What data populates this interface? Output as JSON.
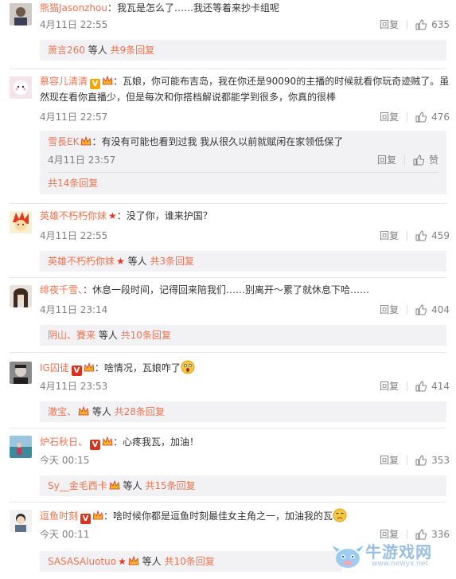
{
  "comments": [
    {
      "user": "熊猫Jasonzhou",
      "text": "：我瓦是怎么了……我还等着来抄卡组呢",
      "time": "4月11日 22:55",
      "reply": "回复",
      "likes": "635",
      "replies": {
        "user": "萧言260",
        "mid": " 等人 ",
        "count": "共9条回复"
      }
    },
    {
      "user": "慕容儿清清",
      "text1": "：瓦娘，你可能布吉岛，我在你还是90090的主播的时候就看你玩奇迹贼了。虽",
      "text2": "然现在看你直播少，但是每次和你搭档解说都能学到很多，你真的很棒",
      "time": "4月11日 22:57",
      "reply": "回复",
      "likes": "476",
      "sub": {
        "user": "雪長EK",
        "text": "：有没有可能也看到过我 我从很久以前就赋闲在家领低保了",
        "time": "4月11日 23:57",
        "reply": "回复",
        "likes": "赞"
      },
      "total": "共14条回复"
    },
    {
      "user": "英雄不朽朽你妹",
      "text": "：没了你，谁来护国？",
      "time": "4月11日 22:55",
      "reply": "回复",
      "likes": "459",
      "replies": {
        "user": "英雄不朽朽你妹",
        "mid": " 等人 ",
        "count": "共3条回复"
      }
    },
    {
      "user": "绯夜千雪、",
      "text": "：休息一段时间，记得回来陪我们……别离开～累了就休息下哈……",
      "time": "4月11日 23:14",
      "reply": "回复",
      "likes": "404",
      "replies": {
        "user": "阴山、賽来",
        "mid": " 等人 ",
        "count": "共10条回复"
      }
    },
    {
      "user": "IG囚徒",
      "text": "：啥情况，瓦娘咋了",
      "time": "4月11日 23:53",
      "reply": "回复",
      "likes": "414",
      "replies": {
        "user": "澈宝、",
        "mid": " 等人 ",
        "count": "共28条回复"
      }
    },
    {
      "user": "炉石秋日、",
      "text": "：心疼我瓦，加油！",
      "time": "今天 00:15",
      "reply": "回复",
      "likes": "353",
      "replies": {
        "user": "Sy__金毛西卡",
        "mid": " 等人 ",
        "count": "共15条回复"
      }
    },
    {
      "user": "逗鱼时刻",
      "text": "：啥时候你都是逗鱼时刻最佳女主角之一，加油我的瓦",
      "time": "今天 00:11",
      "reply": "回复",
      "likes": "336",
      "replies": {
        "user": "SASASAluotuo",
        "mid": " 等人 ",
        "count": "共10条回复"
      }
    }
  ],
  "watermark": {
    "brand": "牛游戏网",
    "url": "www.newyx.net"
  },
  "colors": {
    "accent": "#eb7350",
    "meta": "#808080",
    "replybox": "#f2f2f5"
  }
}
